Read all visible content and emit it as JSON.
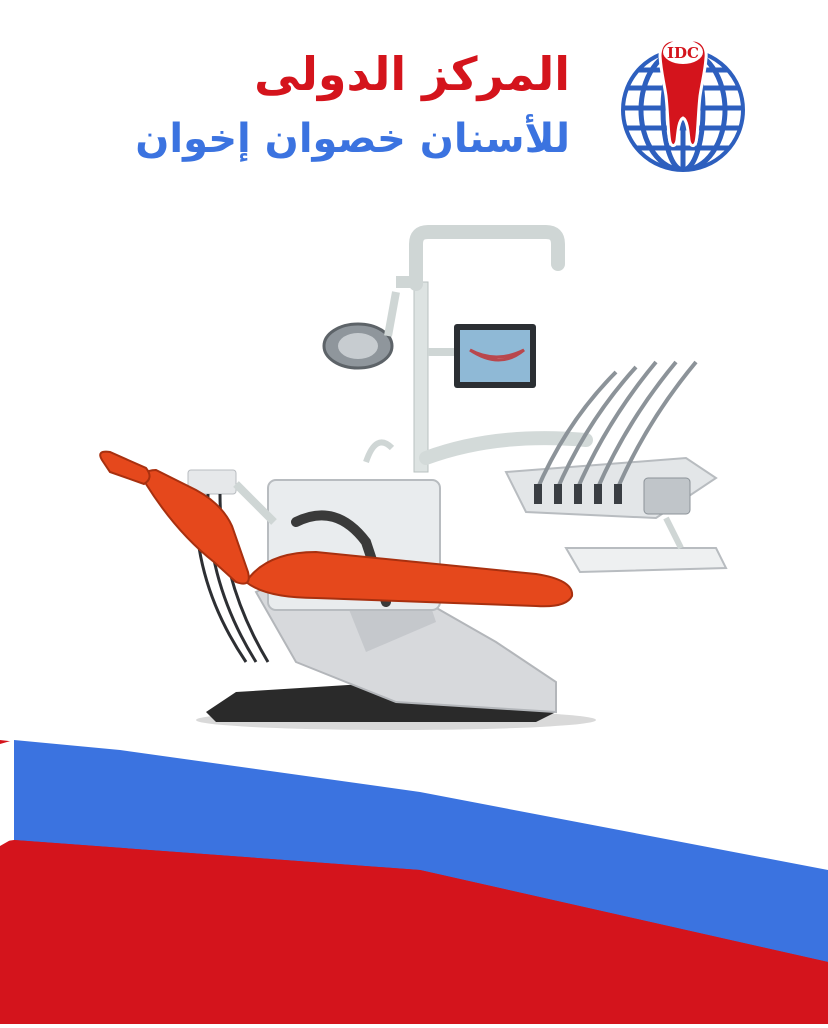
{
  "header": {
    "title_line1": "المركز الدولى",
    "title_line2": "للأسنان خصوان إخوان"
  },
  "logo": {
    "text": "IDC",
    "icon": "globe-tooth-logo"
  },
  "illustration": {
    "icon": "dental-chair-unit",
    "screen_icon": "smile-monitor"
  },
  "colors": {
    "red": "#d4141c",
    "blue": "#3b73e0",
    "logo_blue": "#2d5fbe",
    "chair_orange": "#e5481c",
    "white": "#ffffff"
  }
}
